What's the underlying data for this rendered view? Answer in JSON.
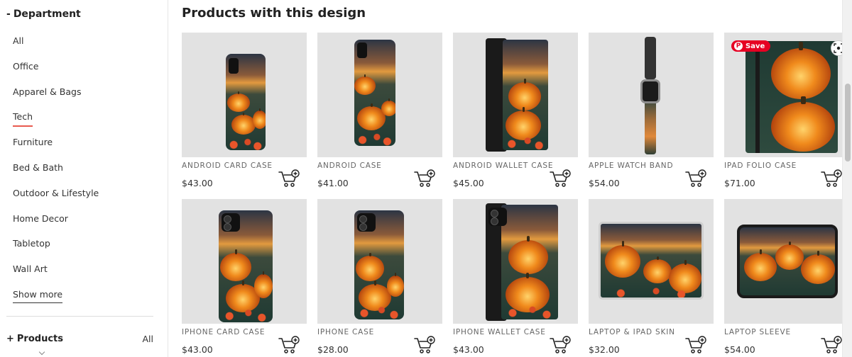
{
  "sidebar": {
    "department_header": "Department",
    "department_toggle": "-",
    "items": [
      {
        "label": "All"
      },
      {
        "label": "Office"
      },
      {
        "label": "Apparel & Bags"
      },
      {
        "label": "Tech",
        "active": true
      },
      {
        "label": "Furniture"
      },
      {
        "label": "Bed & Bath"
      },
      {
        "label": "Outdoor & Lifestyle"
      },
      {
        "label": "Home Decor"
      },
      {
        "label": "Tabletop"
      },
      {
        "label": "Wall Art"
      }
    ],
    "show_more": "Show more",
    "products_toggle": "+",
    "products_header": "Products",
    "products_value": "All"
  },
  "main": {
    "title": "Products with this design",
    "save_label": "Save",
    "products": [
      {
        "name": "ANDROID CARD CASE",
        "price": "$43.00"
      },
      {
        "name": "ANDROID CASE",
        "price": "$41.00"
      },
      {
        "name": "ANDROID WALLET CASE",
        "price": "$45.00"
      },
      {
        "name": "APPLE WATCH BAND",
        "price": "$54.00"
      },
      {
        "name": "IPAD FOLIO CASE",
        "price": "$71.00"
      },
      {
        "name": "IPHONE CARD CASE",
        "price": "$43.00"
      },
      {
        "name": "IPHONE CASE",
        "price": "$28.00"
      },
      {
        "name": "IPHONE WALLET CASE",
        "price": "$43.00"
      },
      {
        "name": "LAPTOP & IPAD SKIN",
        "price": "$32.00"
      },
      {
        "name": "LAPTOP SLEEVE",
        "price": "$54.00"
      }
    ]
  },
  "colors": {
    "accent_underline": "#e85a4f",
    "pinterest": "#e60023"
  }
}
